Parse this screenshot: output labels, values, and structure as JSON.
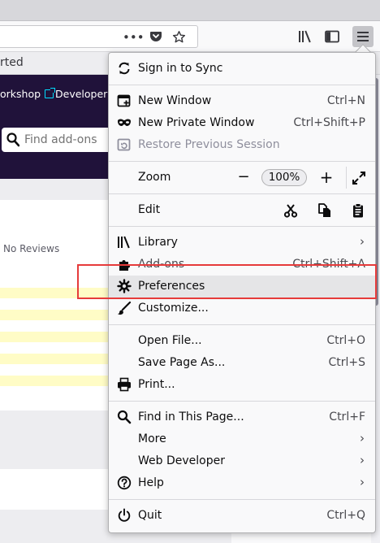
{
  "bookmarks": {
    "partial_text": "rted"
  },
  "site": {
    "nav_links": [
      "orkshop",
      "Developer H"
    ],
    "search_placeholder": "Find add-ons"
  },
  "listing": {
    "no_reviews": "No Reviews"
  },
  "menu": {
    "sync": "Sign in to Sync",
    "new_window": {
      "label": "New Window",
      "shortcut": "Ctrl+N"
    },
    "new_private_window": {
      "label": "New Private Window",
      "shortcut": "Ctrl+Shift+P"
    },
    "restore_session": "Restore Previous Session",
    "zoom": {
      "label": "Zoom",
      "minus": "−",
      "level": "100%",
      "plus": "+"
    },
    "edit": "Edit",
    "library": "Library",
    "addons": {
      "label": "Add-ons",
      "shortcut": "Ctrl+Shift+A"
    },
    "preferences": "Preferences",
    "customize": "Customize...",
    "open_file": {
      "label": "Open File...",
      "shortcut": "Ctrl+O"
    },
    "save_page": {
      "label": "Save Page As...",
      "shortcut": "Ctrl+S"
    },
    "print": "Print...",
    "find": {
      "label": "Find in This Page...",
      "shortcut": "Ctrl+F"
    },
    "more": "More",
    "web_developer": "Web Developer",
    "help": "Help",
    "quit": {
      "label": "Quit",
      "shortcut": "Ctrl+Q"
    }
  },
  "colors": {
    "site_header": "#20123a",
    "link_accent": "#00ddff",
    "highlight_row": "#fffcc6",
    "annotation_box": "#e63b3b"
  }
}
